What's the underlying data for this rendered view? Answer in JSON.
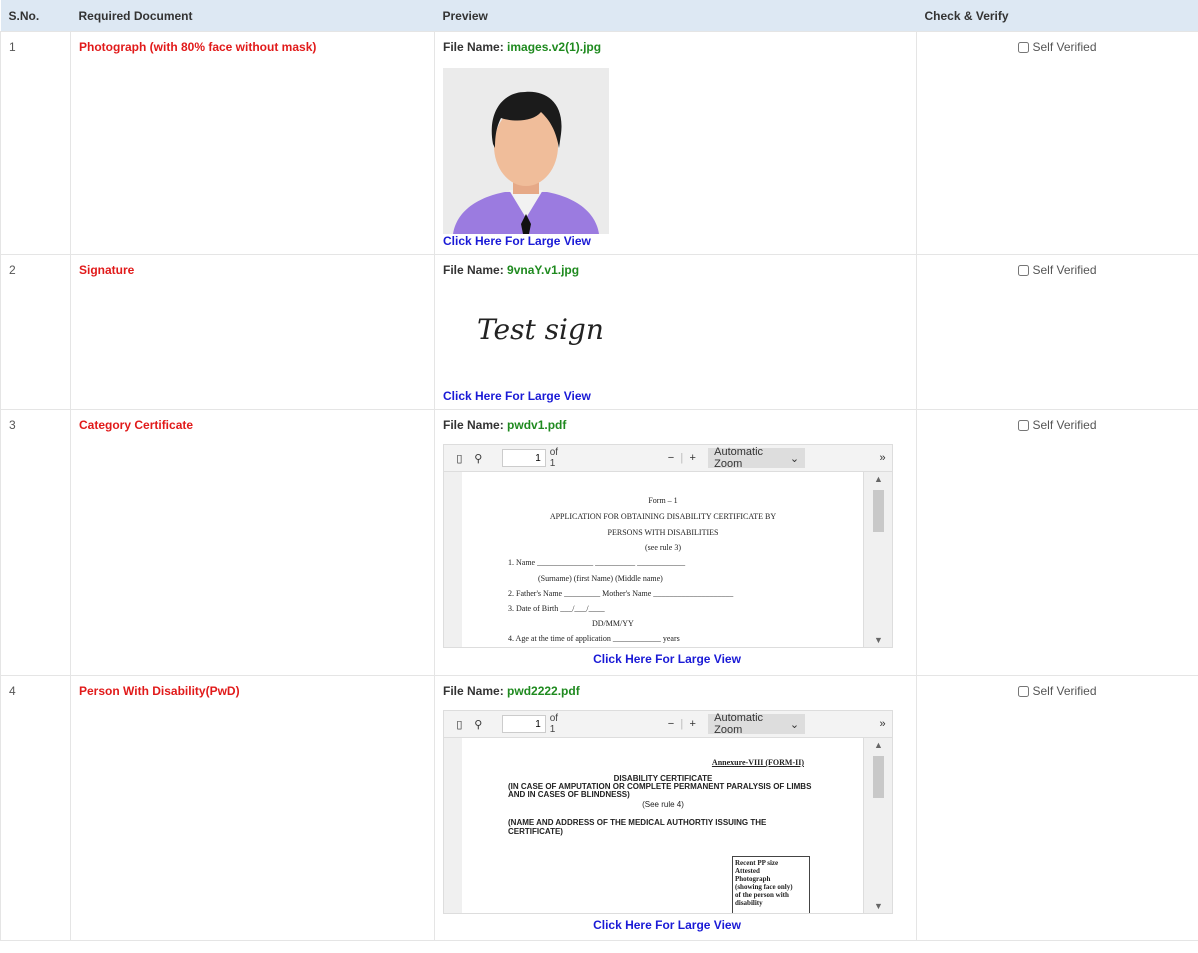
{
  "headers": {
    "sno": "S.No.",
    "doc": "Required Document",
    "preview": "Preview",
    "verify": "Check & Verify"
  },
  "file_name_label": "File Name:",
  "large_view_label": "Click Here For Large View",
  "self_verified_label": "Self Verified",
  "rows": [
    {
      "sno": "1",
      "doc": "Photograph (with 80% face without mask)",
      "file": "images.v2(1).jpg"
    },
    {
      "sno": "2",
      "doc": "Signature",
      "file": "9vnaY.v1.jpg",
      "signature_text": "Test sign"
    },
    {
      "sno": "3",
      "doc": "Category Certificate",
      "file": "pwdv1.pdf"
    },
    {
      "sno": "4",
      "doc": "Person With Disability(PwD)",
      "file": "pwd2222.pdf"
    }
  ],
  "pdf_viewer": {
    "page": "1",
    "of": "of 1",
    "zoom": "Automatic Zoom"
  },
  "pdf1": {
    "l1": "Form – 1",
    "l2": "APPLICATION FOR OBTAINING DISABILITY CERTIFICATE BY",
    "l3": "PERSONS WITH DISABILITIES",
    "l4": "(see rule 3)",
    "l5": "1.    Name ______________   __________      ____________",
    "l6": "(Surname)          (first Name)        (Middle name)",
    "l7": "2.    Father's Name _________  Mother's Name ____________________",
    "l8": "3.    Date of Birth ___/___/____",
    "l9": "DD/MM/YY",
    "l10": "4.    Age at the time of application ____________ years"
  },
  "pdf2": {
    "l1": "Annexure-VIII (FORM-II)",
    "l2": "DISABILITY CERTIFICATE",
    "l3": "(IN CASE OF AMPUTATION OR COMPLETE PERMANENT PARALYSIS OF LIMBS",
    "l4": "AND IN CASES OF BLINDNESS)",
    "l5": "(See rule 4)",
    "l6": "(NAME AND ADDRESS OF THE MEDICAL AUTHORTIY ISSUING THE",
    "l7": "CERTIFICATE)",
    "box": [
      "Recent PP size",
      "Attested",
      "Photograph",
      "(showing face only)",
      "of the person with",
      "disability"
    ]
  },
  "colors": {
    "header_bg": "#dde8f3",
    "doc_red": "#e11a1a",
    "file_green": "#1f8a1f",
    "link_blue": "#1a1ad6"
  }
}
